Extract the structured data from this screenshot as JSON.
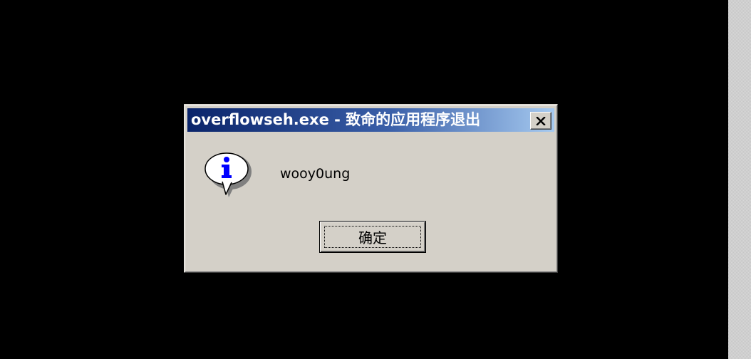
{
  "dialog": {
    "title": "overflowseh.exe - 致命的应用程序退出",
    "message": "wooy0ung",
    "icon": "information-icon",
    "ok_label": "确定",
    "close_icon": "close-icon"
  },
  "colors": {
    "desktop": "#000000",
    "dialog_face": "#d4d0c8",
    "title_start": "#0a246a",
    "title_end": "#a6caf0",
    "icon_blue": "#0000ff"
  }
}
